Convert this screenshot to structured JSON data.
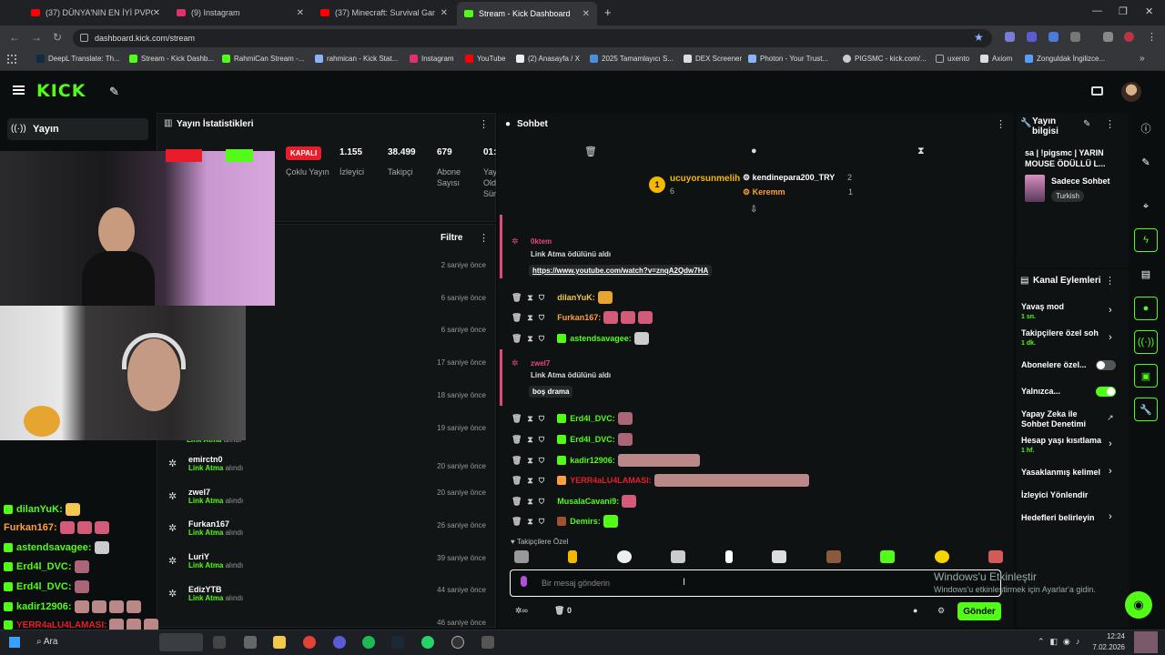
{
  "browser": {
    "tabs": [
      {
        "label": "(37) DÜNYA'NIN EN İYİ PVPCİSİ",
        "color": "#ff0000"
      },
      {
        "label": "(9) Instagram",
        "color": "#e1306c"
      },
      {
        "label": "(37) Minecraft: Survival Games",
        "color": "#ff0000"
      },
      {
        "label": "Stream - Kick Dashboard",
        "color": "#53fc18"
      }
    ],
    "url": "dashboard.kick.com/stream",
    "bookmarks": [
      "DeepL Translate: Th...",
      "Stream - Kick Dashb...",
      "RahmiCan Stream -...",
      "rahmican - Kick Stat...",
      "Instagram",
      "YouTube",
      "(2) Anasayfa / X",
      "2025 Tamamlayıcı S...",
      "DEX Screener",
      "Photon - Your Trust...",
      "PIGSMC - kick.com/...",
      "uxento",
      "Axiom",
      "Zonguldak İngilizce..."
    ]
  },
  "kick": {
    "logo": "KICK",
    "yayin": "Yayın"
  },
  "stats": {
    "title": "Yayın İstatistikleri",
    "status": "KAPALI",
    "items": [
      {
        "value": "",
        "label": "Çoklu Yayın"
      },
      {
        "value": "1.155",
        "label": "İzleyici"
      },
      {
        "value": "38.499",
        "label": "Takipçi"
      },
      {
        "value": "679",
        "label": "Abone Sayısı"
      },
      {
        "value": "01:",
        "label": "Yay Old Sür"
      }
    ],
    "filter": "Filtre",
    "times": [
      "2 saniye önce",
      "6 saniye önce",
      "6 saniye önce",
      "17 saniye önce",
      "18 saniye önce",
      "19 saniye önce"
    ],
    "events": [
      {
        "name": "emirctn0",
        "sub": "Link Atma",
        "act": "alındı",
        "time": "20 saniye önce"
      },
      {
        "name": "zwel7",
        "sub": "Link Atma",
        "act": "alındı",
        "time": "20 saniye önce"
      },
      {
        "name": "Furkan167",
        "sub": "Link Atma",
        "act": "alındı",
        "time": "26 saniye önce"
      },
      {
        "name": "LuriY",
        "sub": "Link Atma",
        "act": "alındı",
        "time": "39 saniye önce"
      },
      {
        "name": "EdizYTB",
        "sub": "Link Atma",
        "act": "alındı",
        "time": "44 saniye önce"
      }
    ],
    "partial": {
      "sub": "Link Atma",
      "act": "alındı",
      "time": "46 saniye önce"
    }
  },
  "overlay_chat": [
    {
      "name": "dilanYuK",
      "color": "#f2c94c"
    },
    {
      "name": "Furkan167",
      "color": "#ff9e3d"
    },
    {
      "name": "astendsavagee",
      "color": "#53fc18"
    },
    {
      "name": "Erd4l_DVC",
      "color": "#53fc18"
    },
    {
      "name": "Erd4l_DVC",
      "color": "#53fc18"
    },
    {
      "name": "kadir12906",
      "color": "#53fc18"
    },
    {
      "name": "YERR4aLU4LAMASI",
      "color": "#e91d2a"
    }
  ],
  "chat": {
    "title": "Sohbet",
    "top": {
      "first": "ucuyorsunmelih",
      "first_count": "6",
      "second": "kendinepara200_TRY",
      "second_count": "2",
      "third": "Keremm",
      "third_count": "1",
      "rank": "1"
    },
    "redeems": [
      {
        "user": "0ktem",
        "text": "Link Atma ödülünü aldı",
        "pill": "https://www.youtube.com/watch?v=znqA2Qdw7HA"
      },
      {
        "user": "zwel7",
        "text": "Link Atma ödülünü aldı",
        "pill": "boş drama"
      }
    ],
    "messages": [
      {
        "name": "dilanYuK:",
        "color": "#f2c94c"
      },
      {
        "name": "Furkan167:",
        "color": "#ff9e3d"
      },
      {
        "name": "astendsavagee:",
        "color": "#53fc18"
      },
      {
        "name": "Erd4l_DVC:",
        "color": "#53fc18"
      },
      {
        "name": "Erd4l_DVC:",
        "color": "#53fc18"
      },
      {
        "name": "kadir12906:",
        "color": "#53fc18"
      },
      {
        "name": "YERR4aLU4LAMASI:",
        "color": "#e91d2a"
      },
      {
        "name": "MusalaCavani9:",
        "color": "#53fc18"
      },
      {
        "name": "Demirs:",
        "color": "#53fc18"
      }
    ],
    "followers_only": "Takipçilere Özel",
    "placeholder": "Bir mesaj gönderin",
    "send": "Gönder",
    "count": "0"
  },
  "info": {
    "title": "Yayın bilgisi",
    "stream_title": "sa | !pigsmc | YARIN MOUSE ÖDÜLLÜ L...",
    "category": "Sadece Sohbet",
    "language": "Turkish"
  },
  "actions": {
    "title": "Kanal Eylemleri",
    "items": [
      {
        "label": "Yavaş mod",
        "sub": "1 sn."
      },
      {
        "label": "Takipçilere özel soh",
        "sub": "1 dk."
      },
      {
        "label": "Abonelere özel...",
        "sub": ""
      },
      {
        "label": "Yalnızca...",
        "sub": ""
      },
      {
        "label": "Yapay Zeka ile Sohbet Denetimi",
        "sub": ""
      },
      {
        "label": "Hesap yaşı kısıtlama",
        "sub": "1 hf."
      },
      {
        "label": "Yasaklanmış kelimel",
        "sub": ""
      },
      {
        "label": "İzleyici Yönlendir",
        "sub": ""
      },
      {
        "label": "Hedefleri belirleyin",
        "sub": ""
      }
    ]
  },
  "watermark": {
    "line1": "Windows'u Etkinleştir",
    "line2": "Windows'u etkinleştirmek için Ayarlar'a gidin."
  },
  "taskbar": {
    "search": "Ara",
    "time": "12:24",
    "date": "7.02.2026"
  }
}
